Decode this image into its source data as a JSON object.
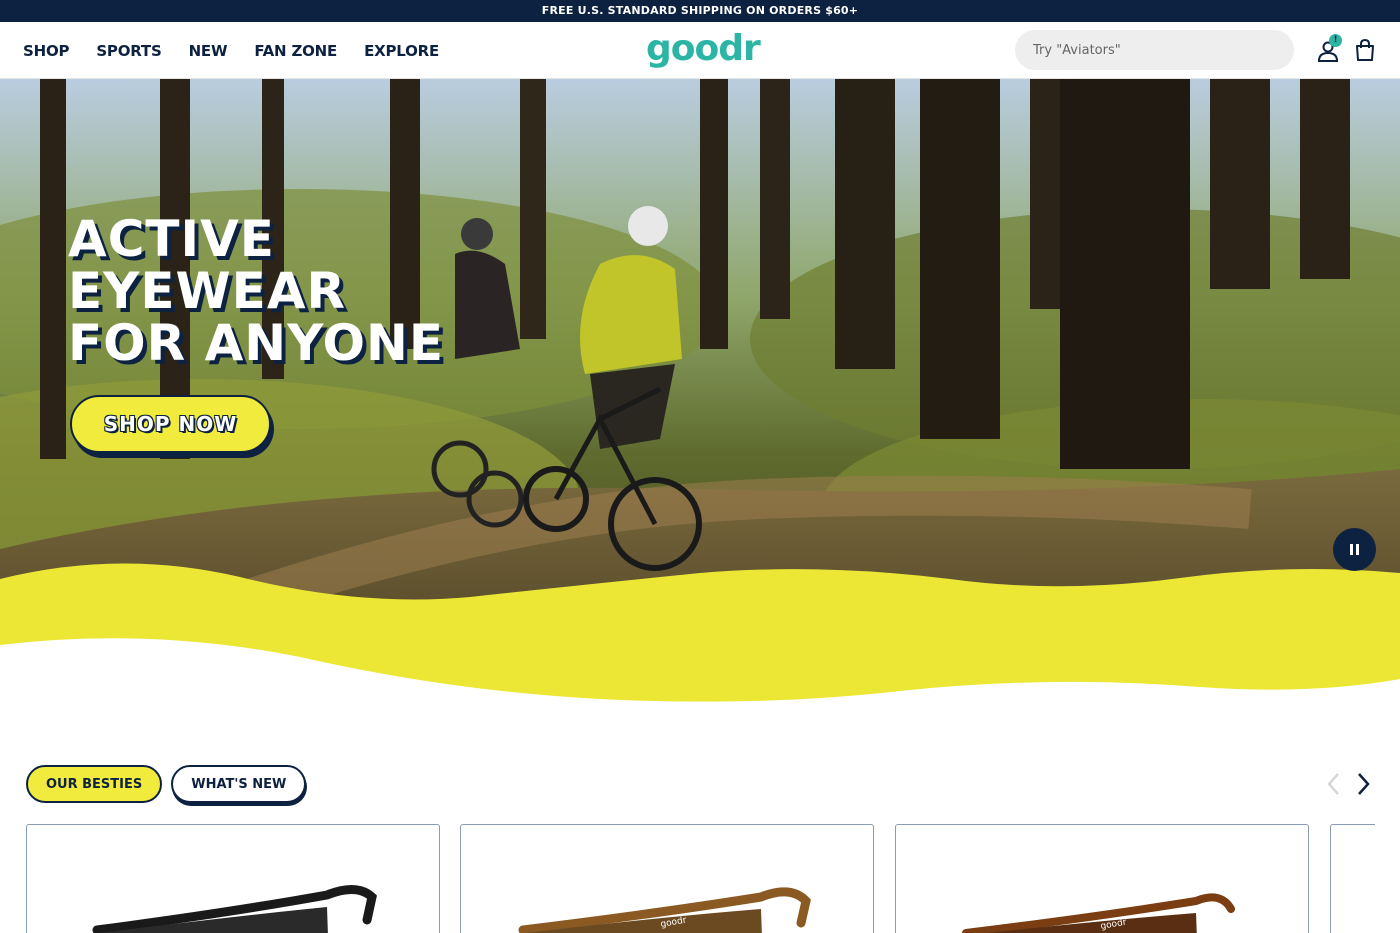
{
  "announcement": "FREE U.S. STANDARD SHIPPING ON ORDERS $60+",
  "nav": {
    "items": [
      {
        "label": "SHOP"
      },
      {
        "label": "SPORTS"
      },
      {
        "label": "NEW"
      },
      {
        "label": "FAN ZONE"
      },
      {
        "label": "EXPLORE"
      }
    ]
  },
  "logo": "goodr",
  "search": {
    "placeholder": "Try \"Aviators\"",
    "value": ""
  },
  "account": {
    "badge": "!"
  },
  "hero": {
    "title_lines": [
      "ACTIVE",
      "EYEWEAR",
      "FOR ANYONE"
    ],
    "cta": "SHOP NOW"
  },
  "product_tabs": [
    {
      "label": "OUR BESTIES",
      "active": true
    },
    {
      "label": "WHAT'S NEW",
      "active": false
    }
  ],
  "product_cards": [
    {
      "frame_color": "#1a1a1a",
      "lens_color": "#3a3a3a",
      "brand_mark": ""
    },
    {
      "frame_color": "#8a5a22",
      "lens_color": "#2e3b4a",
      "brand_mark": "goodr"
    },
    {
      "frame_color": "#7a3e12",
      "lens_color": "#8a3a1e",
      "brand_mark": "goodr"
    }
  ],
  "colors": {
    "navy": "#0d2240",
    "teal": "#2cb5a4",
    "yellow": "#f0eb3c"
  }
}
